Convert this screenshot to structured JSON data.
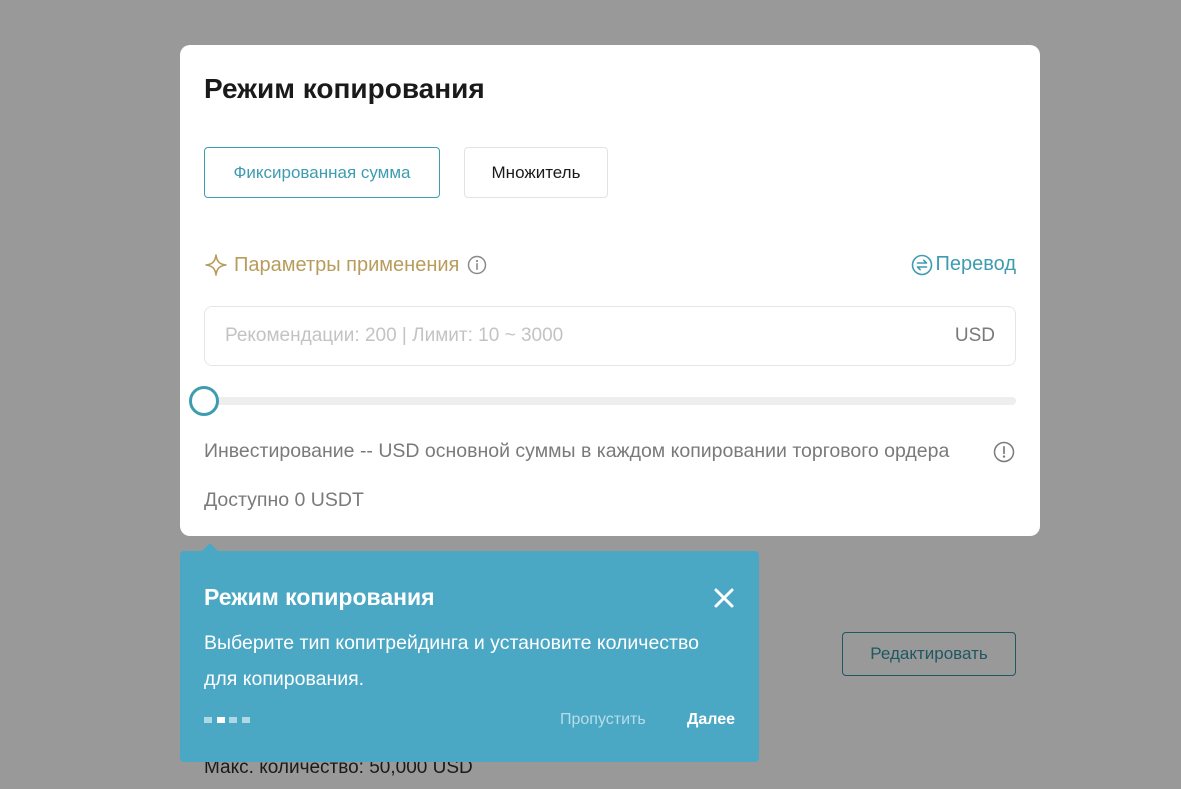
{
  "background": {
    "edit_button_label": "Редактировать",
    "max_quantity_text": "Макс. количество: 50,000 USD"
  },
  "modal": {
    "title": "Режим копирования",
    "modes": [
      {
        "label": "Фиксированная сумма",
        "selected": true
      },
      {
        "label": "Множитель",
        "selected": false
      }
    ],
    "params_label": "Параметры применения",
    "transfer_label": "Перевод",
    "amount_input": {
      "value": "",
      "placeholder": "Рекомендации: 200 | Лимит: 10 ~ 3000",
      "unit": "USD"
    },
    "slider_value": 0,
    "invest_text": "Инвестирование -- USD основной суммы в каждом копировании торгового ордера",
    "available_text": "Доступно 0 USDT"
  },
  "tooltip": {
    "title": "Режим копирования",
    "body": "Выберите тип копитрейдинга и установите количество для копирования.",
    "step_current": 2,
    "step_total": 4,
    "skip_label": "Пропустить",
    "next_label": "Далее"
  },
  "colors": {
    "accent": "#3e9cb0",
    "tooltip_bg": "#4ba8c4",
    "gold": "#b89c5c",
    "overlay": "#999999"
  }
}
